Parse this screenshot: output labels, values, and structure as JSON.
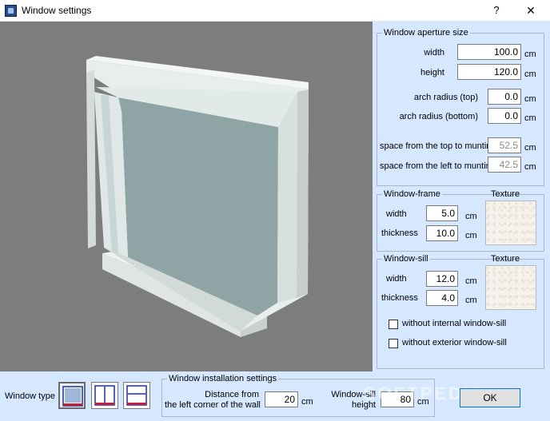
{
  "window": {
    "title": "Window settings",
    "help_label": "?",
    "close_label": "✕"
  },
  "aperture": {
    "group_title": "Window aperture size",
    "width_label": "width",
    "width_value": "100.0",
    "height_label": "height",
    "height_value": "120.0",
    "arch_top_label": "arch radius (top)",
    "arch_top_value": "0.0",
    "arch_bottom_label": "arch radius (bottom)",
    "arch_bottom_value": "0.0",
    "muntin_top_label": "space from the top to muntin",
    "muntin_top_value": "52.5",
    "muntin_left_label": "space from the left to muntin",
    "muntin_left_value": "42.5",
    "unit": "cm"
  },
  "frame": {
    "group_title": "Window-frame",
    "texture_label": "Texture",
    "width_label": "width",
    "width_value": "5.0",
    "thickness_label": "thickness",
    "thickness_value": "10.0",
    "unit": "cm"
  },
  "sill": {
    "group_title": "Window-sill",
    "texture_label": "Texture",
    "width_label": "width",
    "width_value": "12.0",
    "thickness_label": "thickness",
    "thickness_value": "4.0",
    "unit": "cm",
    "no_internal_label": "without internal window-sill",
    "no_internal_checked": false,
    "no_exterior_label": "without exterior window-sill",
    "no_exterior_checked": false
  },
  "bottom": {
    "window_type_label": "Window type",
    "install_group_title": "Window installation settings",
    "distance_label_1": "Distance from",
    "distance_label_2": "the left corner of the wall",
    "distance_value": "20",
    "sill_height_label_1": "Window-sill",
    "sill_height_label_2": "height",
    "sill_height_value": "80",
    "unit": "cm",
    "ok_label": "OK"
  },
  "watermark": "SOFTPEDIA",
  "colors": {
    "panel_bg": "#d6e8ff",
    "viewport_bg": "#7d7d7d",
    "glass": "#8ea3a3",
    "frame": "#e4ebe9"
  }
}
